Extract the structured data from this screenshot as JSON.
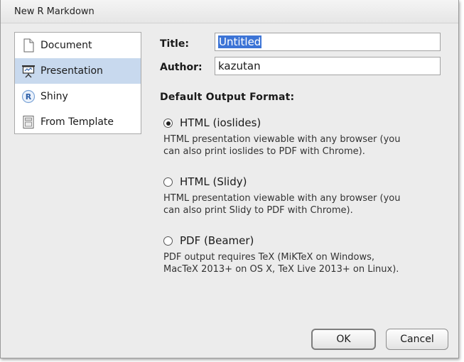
{
  "dialog": {
    "title": "New R Markdown"
  },
  "sidebar": {
    "items": [
      {
        "label": "Document",
        "icon": "document-icon",
        "selected": false
      },
      {
        "label": "Presentation",
        "icon": "presentation-icon",
        "selected": true
      },
      {
        "label": "Shiny",
        "icon": "shiny-icon",
        "selected": false
      },
      {
        "label": "From Template",
        "icon": "template-icon",
        "selected": false
      }
    ]
  },
  "form": {
    "title_label": "Title:",
    "title_value": "Untitled",
    "author_label": "Author:",
    "author_value": "kazutan"
  },
  "output": {
    "heading": "Default Output Format:",
    "options": [
      {
        "label": "HTML (ioslides)",
        "checked": true,
        "description_line1": "HTML presentation viewable with any browser (you",
        "description_line2": "can also print ioslides to PDF with Chrome)."
      },
      {
        "label": "HTML (Slidy)",
        "checked": false,
        "description_line1": "HTML presentation viewable with any browser (you",
        "description_line2": "can also print Slidy to PDF with Chrome)."
      },
      {
        "label": "PDF (Beamer)",
        "checked": false,
        "description_line1": "PDF output requires TeX (MiKTeX on Windows,",
        "description_line2": "MacTeX 2013+ on OS X, TeX Live 2013+ on Linux)."
      }
    ]
  },
  "buttons": {
    "ok": "OK",
    "cancel": "Cancel"
  },
  "colors": {
    "selection": "#c8d9ee",
    "text_selection": "#3c74d6",
    "dialog_bg": "#ececec"
  }
}
